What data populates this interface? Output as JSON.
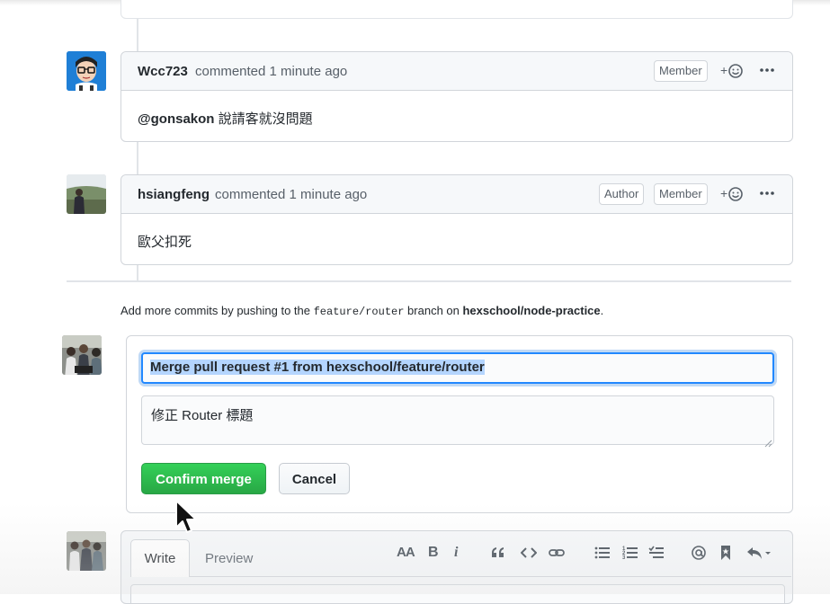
{
  "comments": [
    {
      "author": "Wcc723",
      "meta": "commented 1 minute ago",
      "badges": [
        "Member"
      ],
      "body_mention": "@gonsakon",
      "body_text": " 說請客就沒問題"
    },
    {
      "author": "hsiangfeng",
      "meta": "commented 1 minute ago",
      "badges": [
        "Author",
        "Member"
      ],
      "body_text": "歐父扣死"
    }
  ],
  "info": {
    "prefix": "Add more commits by pushing to the ",
    "branch": "feature/router",
    "middle": " branch on ",
    "repo": "hexschool/node-practice",
    "suffix": "."
  },
  "merge": {
    "title_value": "Merge pull request #1 from hexschool/feature/router",
    "message_value": "修正 Router 標題",
    "confirm_label": "Confirm merge",
    "cancel_label": "Cancel"
  },
  "editor": {
    "tabs": [
      "Write",
      "Preview"
    ],
    "toolbar": {
      "heading": "AA",
      "bold": "B",
      "italic": "i",
      "icons": [
        "quote-icon",
        "code-icon",
        "link-icon",
        "bulleted-list-icon",
        "numbered-list-icon",
        "task-list-icon",
        "mention-icon",
        "saved-reply-icon",
        "reply-icon"
      ]
    }
  },
  "colors": {
    "accent_blue": "#2188ff",
    "confirm_green": "#28a745",
    "border": "#d1d5da",
    "header_bg": "#f6f8fa"
  }
}
